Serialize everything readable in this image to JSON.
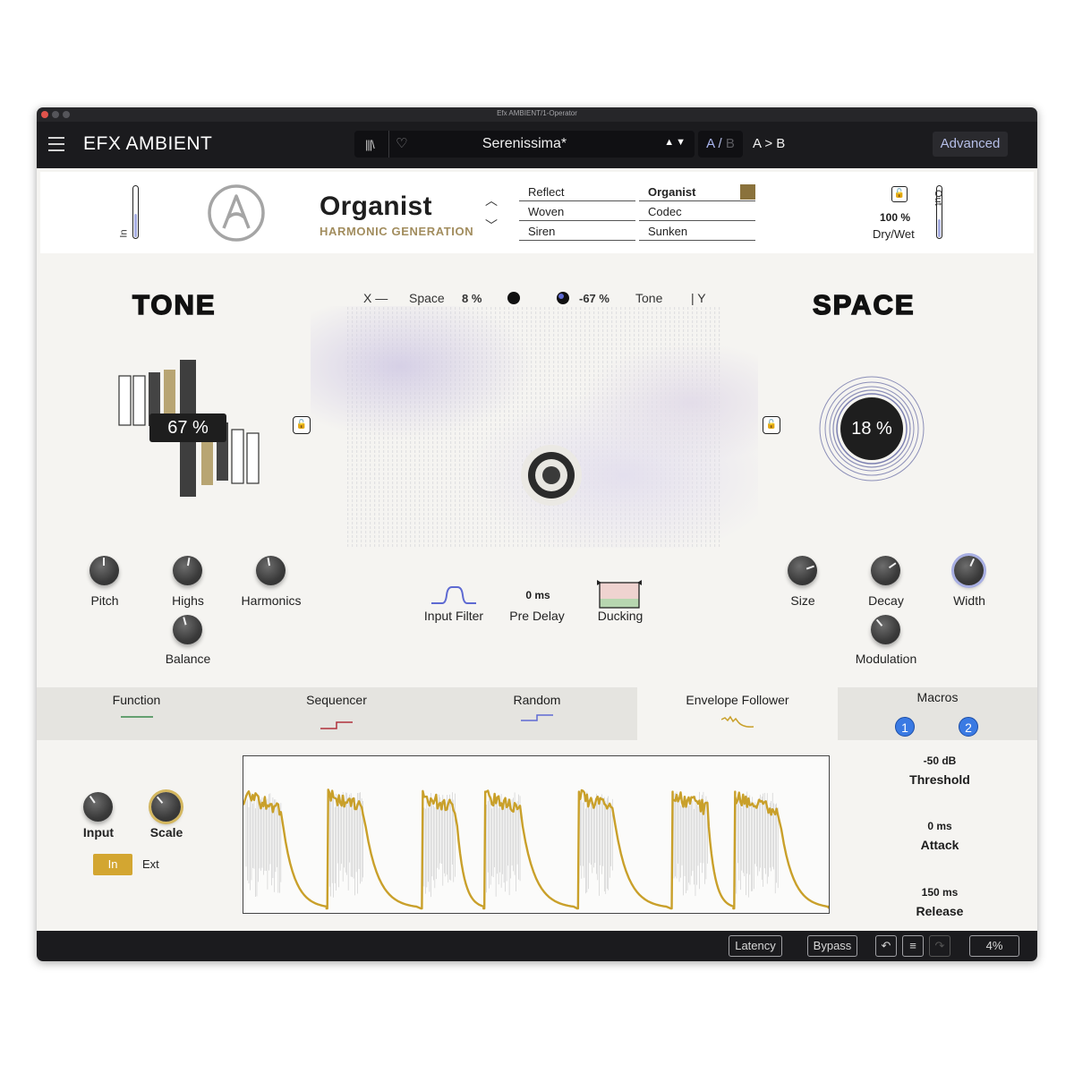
{
  "window_title": "Efx AMBIENT/1-Operator",
  "topbar": {
    "brand_main": "EFX AMBIENT",
    "preset_name": "Serenissima*",
    "preset_arrows": "▲▼",
    "ab_a": "A",
    "ab_slash": "/",
    "ab_b": "B",
    "a_to_b": "A > B",
    "advanced": "Advanced"
  },
  "header": {
    "in_label": "In",
    "out_label": "Out",
    "in_level": 0.45,
    "out_level": 0.35,
    "module_name": "Organist",
    "module_sub": "HARMONIC GENERATION",
    "modules": [
      "Reflect",
      "Organist",
      "Woven",
      "Codec",
      "Siren",
      "Sunken"
    ],
    "selected_module": "Organist",
    "module_color": "#8a723c",
    "drywet_value": "100 %",
    "drywet_label": "Dry/Wet"
  },
  "main": {
    "tone_title": "TONE",
    "space_title": "SPACE",
    "xy": {
      "x_label": "X —",
      "x_param": "Space",
      "x_value": "8 %",
      "y_value": "-67 %",
      "y_param": "Tone",
      "y_label": "| Y"
    },
    "tone_value": "67 %",
    "space_value": "18 %",
    "tone_knobs": [
      {
        "label": "Pitch",
        "angle": 0
      },
      {
        "label": "Highs",
        "angle": 10
      },
      {
        "label": "Harmonics",
        "angle": -10
      },
      {
        "label": "Balance",
        "angle": -15
      }
    ],
    "center_controls": {
      "input_filter": "Input Filter",
      "pre_delay_value": "0 ms",
      "pre_delay": "Pre Delay",
      "ducking": "Ducking"
    },
    "space_knobs": [
      {
        "label": "Size",
        "angle": 70
      },
      {
        "label": "Decay",
        "angle": 55
      },
      {
        "label": "Width",
        "angle": 25
      },
      {
        "label": "Modulation",
        "angle": -40
      }
    ]
  },
  "tabs": {
    "items": [
      "Function",
      "Sequencer",
      "Random",
      "Envelope Follower"
    ],
    "active": "Envelope Follower",
    "macros_label": "Macros",
    "macro_1": "1",
    "macro_2": "2",
    "colors": {
      "function": "#3a8a4a",
      "sequencer": "#b0303a",
      "random": "#5e6ad2",
      "envelope": "#c9a02a"
    }
  },
  "envelope": {
    "input_label": "Input",
    "scale_label": "Scale",
    "in_btn": "In",
    "ext_btn": "Ext",
    "threshold_value": "-50 dB",
    "threshold_label": "Threshold",
    "attack_value": "0 ms",
    "attack_label": "Attack",
    "release_value": "150 ms",
    "release_label": "Release"
  },
  "bottombar": {
    "latency": "Latency",
    "bypass": "Bypass",
    "undo_icon": "↶",
    "list_icon": "≡",
    "redo_icon": "↷",
    "cpu": "4%"
  }
}
